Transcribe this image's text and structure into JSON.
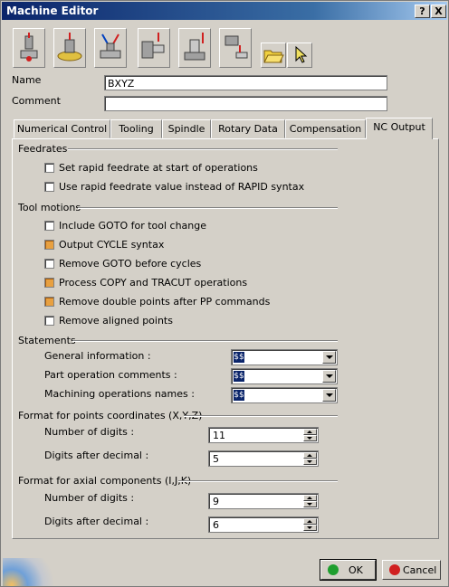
{
  "window": {
    "title": "Machine Editor",
    "help_label": "?",
    "close_label": "X"
  },
  "toolbar": {
    "tools": [
      "3-axis-machine",
      "rotary-table-machine",
      "5-axis-machine",
      "horizontal-lathe",
      "vertical-lathe",
      "multi-slide-lathe"
    ],
    "icons": [
      "open-folder-icon",
      "select-arrow-icon"
    ]
  },
  "form": {
    "name_label": "Name",
    "name_value": "BXYZ",
    "comment_label": "Comment",
    "comment_value": ""
  },
  "tabs": [
    {
      "label": "Numerical Control",
      "active": false
    },
    {
      "label": "Tooling",
      "active": false
    },
    {
      "label": "Spindle",
      "active": false
    },
    {
      "label": "Rotary Data",
      "active": false
    },
    {
      "label": "Compensation",
      "active": false
    },
    {
      "label": "NC Output",
      "active": true
    }
  ],
  "feedrates": {
    "title": "Feedrates",
    "items": [
      {
        "label": "Set rapid feedrate at start of operations",
        "checked": false
      },
      {
        "label": "Use rapid feedrate value instead of RAPID syntax",
        "checked": false
      }
    ]
  },
  "tool_motions": {
    "title": "Tool motions",
    "items": [
      {
        "label": "Include GOTO for tool change",
        "checked": false
      },
      {
        "label": "Output CYCLE syntax",
        "checked": true
      },
      {
        "label": "Remove GOTO before cycles",
        "checked": false
      },
      {
        "label": "Process COPY and TRACUT operations",
        "checked": true
      },
      {
        "label": "Remove double points after PP commands",
        "checked": true
      },
      {
        "label": "Remove aligned points",
        "checked": false
      }
    ]
  },
  "statements": {
    "title": "Statements",
    "rows": [
      {
        "label": "General information :",
        "value": "$$"
      },
      {
        "label": "Part operation comments :",
        "value": "$$"
      },
      {
        "label": "Machining operations names :",
        "value": "$$"
      }
    ]
  },
  "points_format": {
    "title": "Format for points coordinates (X,Y,Z)",
    "digits_label": "Number of digits :",
    "digits_value": "11",
    "decimal_label": "Digits after decimal :",
    "decimal_value": "5"
  },
  "axial_format": {
    "title": "Format for axial components (I,J,K)",
    "digits_label": "Number of digits :",
    "digits_value": "9",
    "decimal_label": "Digits after decimal :",
    "decimal_value": "6"
  },
  "buttons": {
    "ok_label": "OK",
    "cancel_label": "Cancel"
  },
  "colors": {
    "ok_icon": "#1e9e2e",
    "cancel_icon": "#d02020",
    "checked_box": "#e8a040"
  }
}
